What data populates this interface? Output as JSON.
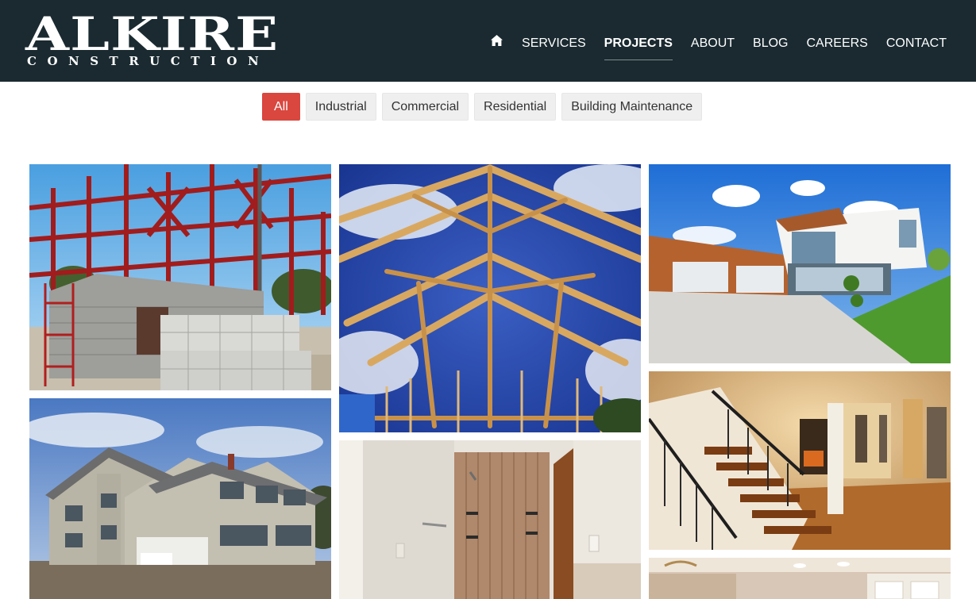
{
  "brand": {
    "name": "ALKIRE",
    "subtitle": "CONSTRUCTION"
  },
  "nav": {
    "home_icon": "home-icon",
    "items": [
      "SERVICES",
      "PROJECTS",
      "ABOUT",
      "BLOG",
      "CAREERS",
      "CONTACT"
    ],
    "active": "PROJECTS"
  },
  "filters": {
    "items": [
      "All",
      "Industrial",
      "Commercial",
      "Residential",
      "Building Maintenance"
    ],
    "active": "All"
  },
  "gallery": {
    "tiles": [
      "steel-frame-and-block-wall",
      "wood-roof-trusses",
      "modern-white-house",
      "beige-two-story-house",
      "tiled-shower-interior",
      "staircase-and-hardwood-floor",
      "kitchen-ceiling-lights"
    ]
  },
  "colors": {
    "header_bg": "#1a2a30",
    "accent": "#d9473f",
    "filter_bg": "#efefef"
  }
}
